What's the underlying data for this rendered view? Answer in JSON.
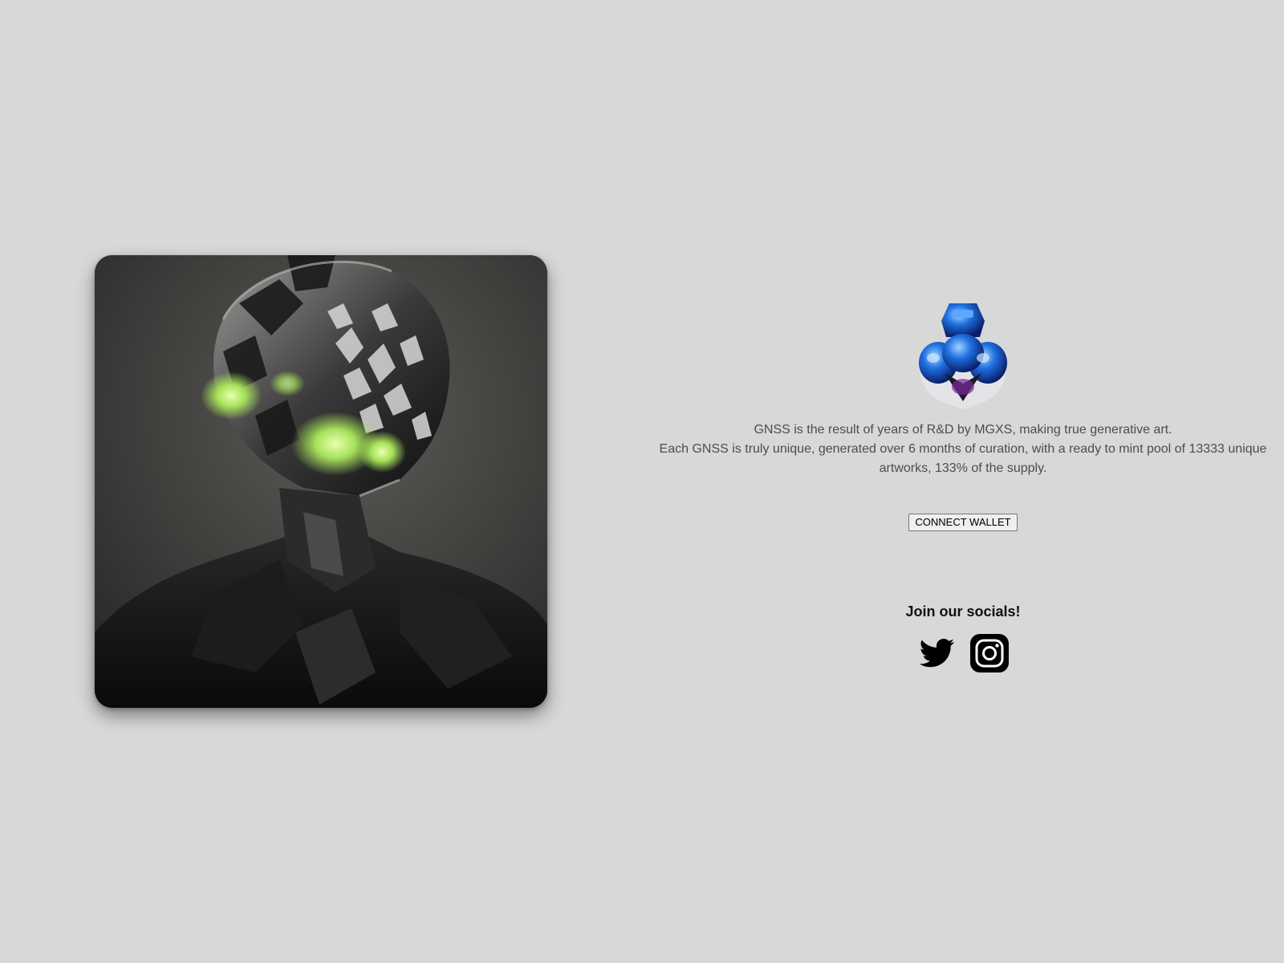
{
  "hero": {
    "image_alt": "Black armored robot figure with glowing green face panels"
  },
  "logo": {
    "icon": "blue-crystal-logo-icon"
  },
  "description": {
    "line1": "GNSS is the result of years of R&D by MGXS, making true generative art.",
    "line2": "Each GNSS is truly unique, generated over 6 months of curation, with a ready to mint pool of 13333 unique artworks, 133% of the supply."
  },
  "wallet": {
    "connect_label": "CONNECT WALLET"
  },
  "socials": {
    "title": "Join our socials!",
    "links": [
      {
        "icon": "twitter-icon"
      },
      {
        "icon": "instagram-icon"
      }
    ]
  },
  "colors": {
    "background": "#d8d8d8",
    "text": "#4d4d4d",
    "glow": "#b8f36a",
    "logo_blue": "#1f6fe0"
  }
}
